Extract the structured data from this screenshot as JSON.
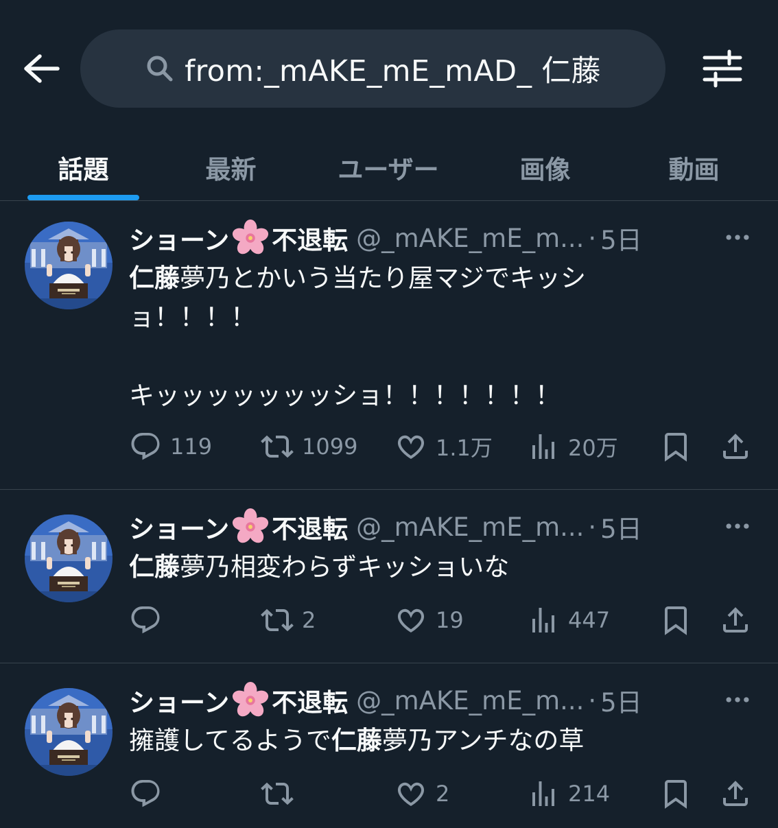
{
  "search": {
    "query": "from:_mAKE_mE_mAD_ 仁藤"
  },
  "tabs": [
    {
      "label": "話題"
    },
    {
      "label": "最新"
    },
    {
      "label": "ユーザー"
    },
    {
      "label": "画像"
    },
    {
      "label": "動画"
    }
  ],
  "colors": {
    "background": "#15202b",
    "accent": "#1d9bf0",
    "muted": "#8b98a5",
    "text": "#f7f9f9"
  },
  "tweets": [
    {
      "name_left": "ショーン",
      "name_right": "不退転",
      "handle": "@_mAKE_mE_m...",
      "dot": "·",
      "time": "5日",
      "line1_bold": "仁藤",
      "line1_rest": "夢乃とかいう当たり屋マジでキッシ",
      "line2": "ョ！！！！",
      "line3": "キッッッッッッッショ！！！！！！！",
      "replies": "119",
      "retweets": "1099",
      "likes": "1.1万",
      "views": "20万"
    },
    {
      "name_left": "ショーン",
      "name_right": "不退転",
      "handle": "@_mAKE_mE_m...",
      "dot": "·",
      "time": "5日",
      "line1_bold": "仁藤",
      "line1_rest": "夢乃相変わらずキッショいな",
      "replies": "",
      "retweets": "2",
      "likes": "19",
      "views": "447"
    },
    {
      "name_left": "ショーン",
      "name_right": "不退転",
      "handle": "@_mAKE_mE_m...",
      "dot": "·",
      "time": "5日",
      "line1_pre": "擁護してるようで",
      "line1_bold": "仁藤",
      "line1_rest": "夢乃アンチなの草",
      "replies": "",
      "retweets": "",
      "likes": "2",
      "views": "214"
    }
  ]
}
